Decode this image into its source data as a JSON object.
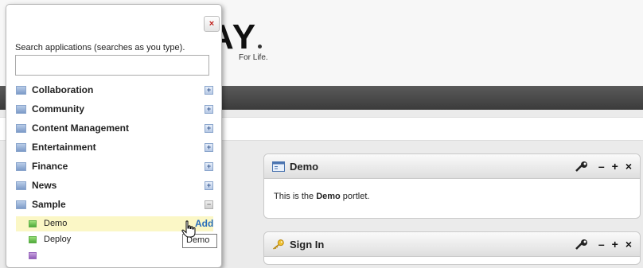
{
  "logo": {
    "letters": "AY",
    "tagline": "For Life."
  },
  "panel": {
    "close_label": "×",
    "search_label": "Search applications (searches as you type).",
    "search_value": "",
    "search_placeholder": "",
    "categories": [
      {
        "label": "Collaboration",
        "state": "collapsed",
        "toggle": "+"
      },
      {
        "label": "Community",
        "state": "collapsed",
        "toggle": "+"
      },
      {
        "label": "Content Management",
        "state": "collapsed",
        "toggle": "+"
      },
      {
        "label": "Entertainment",
        "state": "collapsed",
        "toggle": "+"
      },
      {
        "label": "Finance",
        "state": "collapsed",
        "toggle": "+"
      },
      {
        "label": "News",
        "state": "collapsed",
        "toggle": "+"
      },
      {
        "label": "Sample",
        "state": "expanded",
        "toggle": "−"
      }
    ],
    "apps": [
      {
        "label": "Demo",
        "add_label": "Add",
        "highlighted": true
      },
      {
        "label": "Deploy",
        "add_label": "",
        "highlighted": false
      }
    ],
    "tooltip": "Demo"
  },
  "portlets": [
    {
      "title": "Demo",
      "body_prefix": "This is the ",
      "body_bold": "Demo",
      "body_suffix": " portlet.",
      "icon": "window-icon"
    },
    {
      "title": "Sign In",
      "body_prefix": "",
      "body_bold": "",
      "body_suffix": "",
      "icon": "key-icon"
    }
  ],
  "portlet_controls": {
    "minimize": "–",
    "maximize": "+",
    "close": "×"
  },
  "colors": {
    "accent_link": "#2a6ebb",
    "close_red": "#c0201c",
    "highlight_row": "#fbf7c6",
    "dark_bar": "#4a4a4a"
  }
}
